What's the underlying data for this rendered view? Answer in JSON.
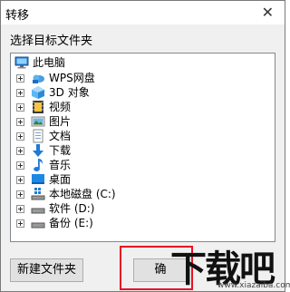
{
  "dialog": {
    "title": "转移",
    "prompt": "选择目标文件夹",
    "close_glyph": "✕"
  },
  "tree": {
    "root": {
      "label": "此电脑",
      "icon": "computer-icon"
    },
    "items": [
      {
        "label": "WPS网盘",
        "icon": "cloud-icon"
      },
      {
        "label": "3D 对象",
        "icon": "3d-objects-icon"
      },
      {
        "label": "视频",
        "icon": "video-icon"
      },
      {
        "label": "图片",
        "icon": "pictures-icon"
      },
      {
        "label": "文档",
        "icon": "documents-icon"
      },
      {
        "label": "下载",
        "icon": "downloads-icon"
      },
      {
        "label": "音乐",
        "icon": "music-icon"
      },
      {
        "label": "桌面",
        "icon": "desktop-icon"
      },
      {
        "label": "本地磁盘 (C:)",
        "icon": "windows-drive-icon"
      },
      {
        "label": "软件 (D:)",
        "icon": "drive-icon"
      },
      {
        "label": "备份 (E:)",
        "icon": "drive-icon"
      }
    ]
  },
  "buttons": {
    "new_folder": "新建文件夹",
    "ok": "确"
  },
  "watermark": {
    "text": "下载吧",
    "url": "www.xiazaiba.com"
  }
}
